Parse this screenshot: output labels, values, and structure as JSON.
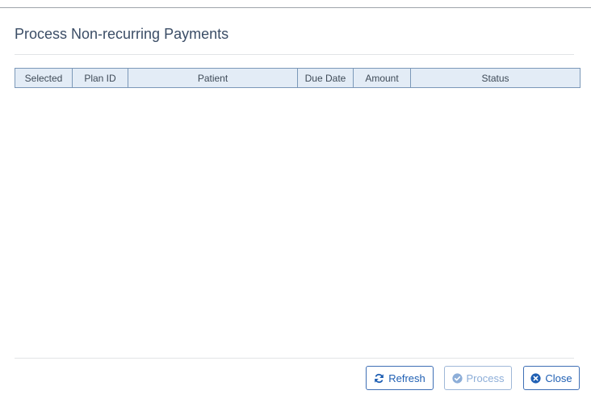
{
  "dialog": {
    "title": "Process Non-recurring Payments"
  },
  "table": {
    "columns": [
      "Selected",
      "Plan ID",
      "Patient",
      "Due Date",
      "Amount",
      "Status"
    ],
    "rows": []
  },
  "buttons": {
    "refresh": {
      "label": "Refresh",
      "icon": "refresh-icon",
      "enabled": true
    },
    "process": {
      "label": "Process",
      "icon": "check-circle-icon",
      "enabled": false
    },
    "close": {
      "label": "Close",
      "icon": "close-circle-icon",
      "enabled": true
    }
  },
  "colors": {
    "title": "#3b4d66",
    "header_bg": "#e3ecf6",
    "header_border": "#7b98b8",
    "button_primary": "#1f5fb3",
    "button_disabled": "#8daed8"
  }
}
